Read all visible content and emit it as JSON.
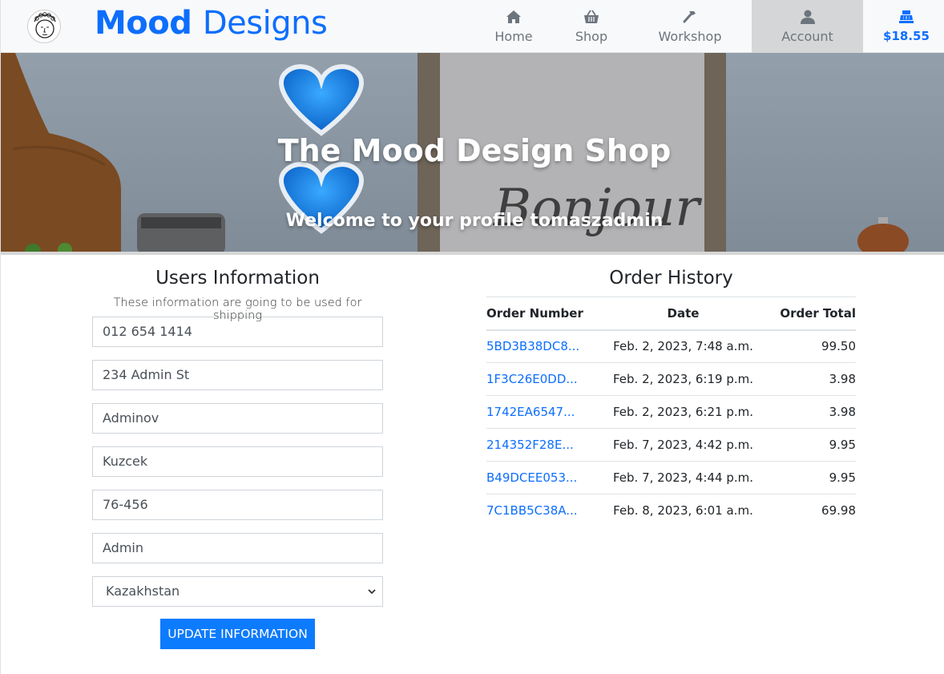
{
  "navbar": {
    "brand_part1": "Mood",
    "brand_part2": "Designs",
    "items": [
      {
        "label": "Home",
        "icon": "home-icon"
      },
      {
        "label": "Shop",
        "icon": "basket-icon"
      },
      {
        "label": "Workshop",
        "icon": "hammer-icon"
      },
      {
        "label": "Account",
        "icon": "user-icon"
      }
    ],
    "cart": {
      "label": "$18.55",
      "icon": "cash-register-icon"
    }
  },
  "hero": {
    "title": "The Mood Design Shop",
    "subtitle": "Welcome to your profile tomaszadmin"
  },
  "users_info": {
    "heading": "Users Information",
    "subtext": "These information are going to be used for shipping",
    "fields": [
      "012 654 1414",
      "234 Admin St",
      "Adminov",
      "Kuzcek",
      "76-456",
      "Admin"
    ],
    "country": "Kazakhstan",
    "update_button": "UPDATE INFORMATION"
  },
  "order_history": {
    "heading": "Order History",
    "columns": [
      "Order Number",
      "Date",
      "Order Total"
    ],
    "rows": [
      {
        "number": "5BD3B38DC8...",
        "date": "Feb. 2, 2023, 7:48 a.m.",
        "total": "99.50"
      },
      {
        "number": "1F3C26E0DD...",
        "date": "Feb. 2, 2023, 6:19 p.m.",
        "total": "3.98"
      },
      {
        "number": "1742EA6547...",
        "date": "Feb. 2, 2023, 6:21 p.m.",
        "total": "3.98"
      },
      {
        "number": "214352F28E...",
        "date": "Feb. 7, 2023, 4:42 p.m.",
        "total": "9.95"
      },
      {
        "number": "B49DCEE053...",
        "date": "Feb. 7, 2023, 4:44 p.m.",
        "total": "9.95"
      },
      {
        "number": "7C1BB5C38A...",
        "date": "Feb. 8, 2023, 6:01 a.m.",
        "total": "69.98"
      }
    ]
  },
  "colors": {
    "accent": "#0d6efd",
    "nav_bg": "#f8f9fa",
    "active_nav_bg": "#d5d6d7"
  }
}
